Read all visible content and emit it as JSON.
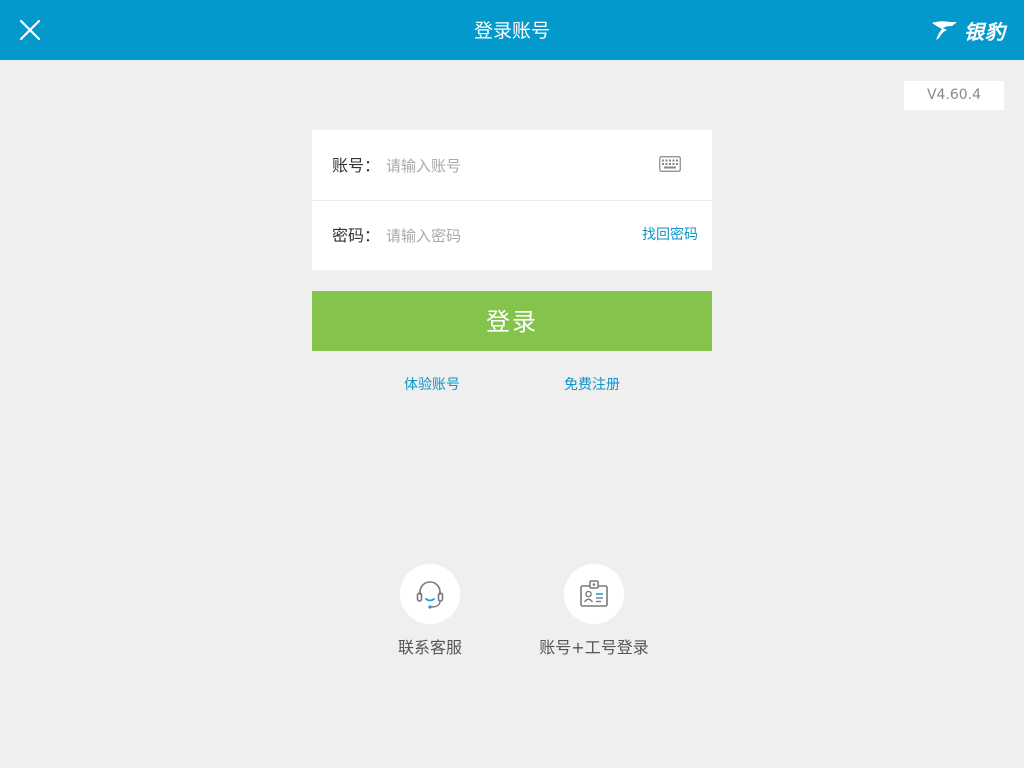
{
  "header": {
    "title": "登录账号",
    "brand_text": "银豹",
    "colors": {
      "bar": "#0499cc",
      "text": "#ffffff"
    }
  },
  "version": "V4.60.4",
  "form": {
    "account": {
      "label": "账号：",
      "placeholder": "请输入账号",
      "icon": "keyboard-icon"
    },
    "password": {
      "label": "密码：",
      "placeholder": "请输入密码",
      "find_link": "找回密码"
    }
  },
  "login_button": {
    "label": "登录",
    "color": "#84c44d"
  },
  "links": {
    "trial": "体验账号",
    "register": "免费注册",
    "color": "#0b95c9"
  },
  "bottom": {
    "service": {
      "label": "联系客服",
      "icon": "headset-icon"
    },
    "staff_login": {
      "label": "账号+工号登录",
      "icon": "id-card-icon"
    }
  }
}
